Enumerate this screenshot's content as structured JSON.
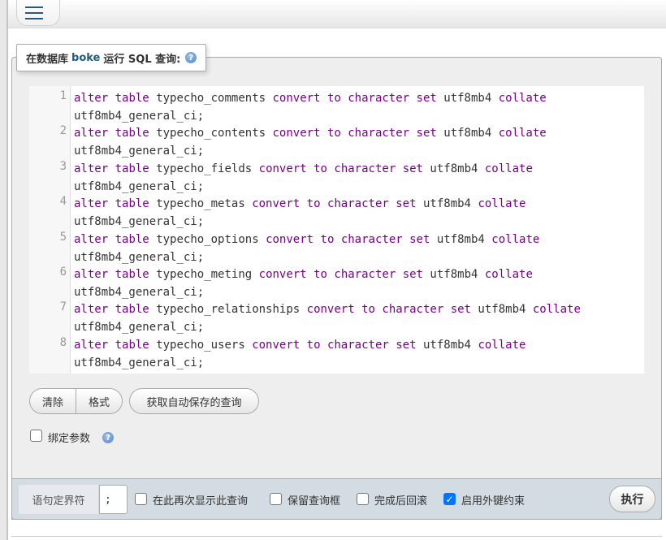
{
  "header": {
    "menu_icon": "hamburger-menu-icon"
  },
  "panel": {
    "title_prefix": "在数据库",
    "database": "boke",
    "title_suffix": "运行 SQL 查询:",
    "help_icon": "help-icon"
  },
  "editor": {
    "lines": [
      {
        "num": "1",
        "table": "typecho_comments"
      },
      {
        "num": "2",
        "table": "typecho_contents"
      },
      {
        "num": "3",
        "table": "typecho_fields"
      },
      {
        "num": "4",
        "table": "typecho_metas"
      },
      {
        "num": "5",
        "table": "typecho_options"
      },
      {
        "num": "6",
        "table": "typecho_meting"
      },
      {
        "num": "7",
        "table": "typecho_relationships"
      },
      {
        "num": "8",
        "table": "typecho_users"
      }
    ],
    "kw_alter": "alter",
    "kw_table": "table",
    "kw_convert": "convert",
    "kw_to": "to",
    "kw_character": "character",
    "kw_set": "set",
    "charset": "utf8mb4",
    "kw_collate": "collate",
    "collation": "utf8mb4_general_ci;",
    "keyword_color": "#770088"
  },
  "buttons": {
    "clear": "清除",
    "format": "格式",
    "get_autosaved": "获取自动保存的查询"
  },
  "bind_params": {
    "label": "绑定参数",
    "checked": false
  },
  "footer": {
    "delimiter_label": "语句定界符",
    "delimiter_value": ";",
    "options": [
      {
        "label": "在此再次显示此查询",
        "checked": false
      },
      {
        "label": "保留查询框",
        "checked": false
      },
      {
        "label": "完成后回滚",
        "checked": false
      },
      {
        "label": "启用外键约束",
        "checked": true
      }
    ],
    "go_button": "执行"
  }
}
